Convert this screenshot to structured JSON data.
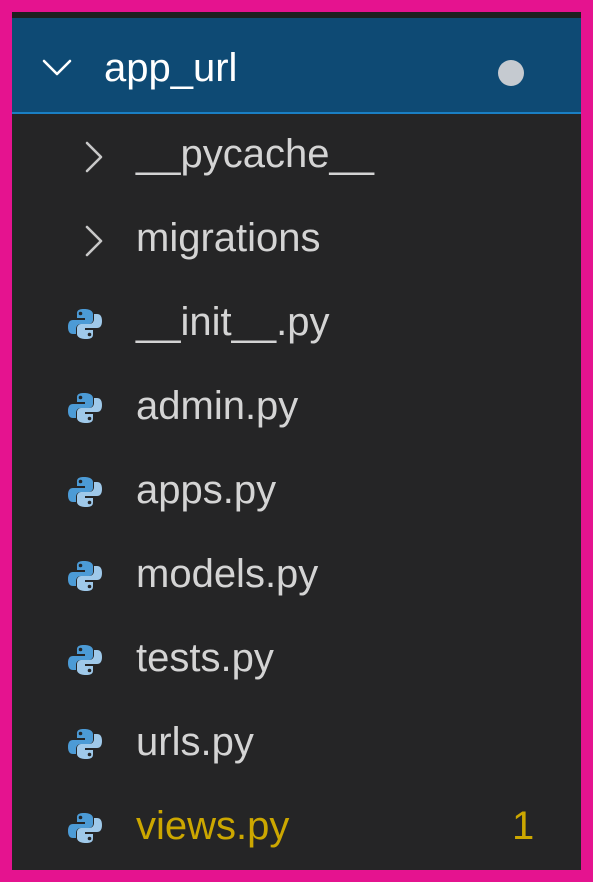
{
  "explorer": {
    "folder": {
      "name": "app_url",
      "expanded": true,
      "modified_indicator": true
    },
    "items": [
      {
        "type": "folder",
        "name": "__pycache__",
        "icon": "chevron-right-icon"
      },
      {
        "type": "folder",
        "name": "migrations",
        "icon": "chevron-right-icon"
      },
      {
        "type": "file",
        "name": "__init__.py",
        "icon": "python-icon"
      },
      {
        "type": "file",
        "name": "admin.py",
        "icon": "python-icon"
      },
      {
        "type": "file",
        "name": "apps.py",
        "icon": "python-icon"
      },
      {
        "type": "file",
        "name": "models.py",
        "icon": "python-icon"
      },
      {
        "type": "file",
        "name": "tests.py",
        "icon": "python-icon"
      },
      {
        "type": "file",
        "name": "urls.py",
        "icon": "python-icon"
      },
      {
        "type": "file",
        "name": "views.py",
        "icon": "python-icon",
        "problems": "1",
        "status_color": "#cca700"
      }
    ]
  },
  "colors": {
    "outer_border": "#e5138f",
    "sidebar_bg": "#252526",
    "selected_bg": "#0e4a74",
    "text": "#d4d4d4",
    "warning": "#cca700"
  }
}
